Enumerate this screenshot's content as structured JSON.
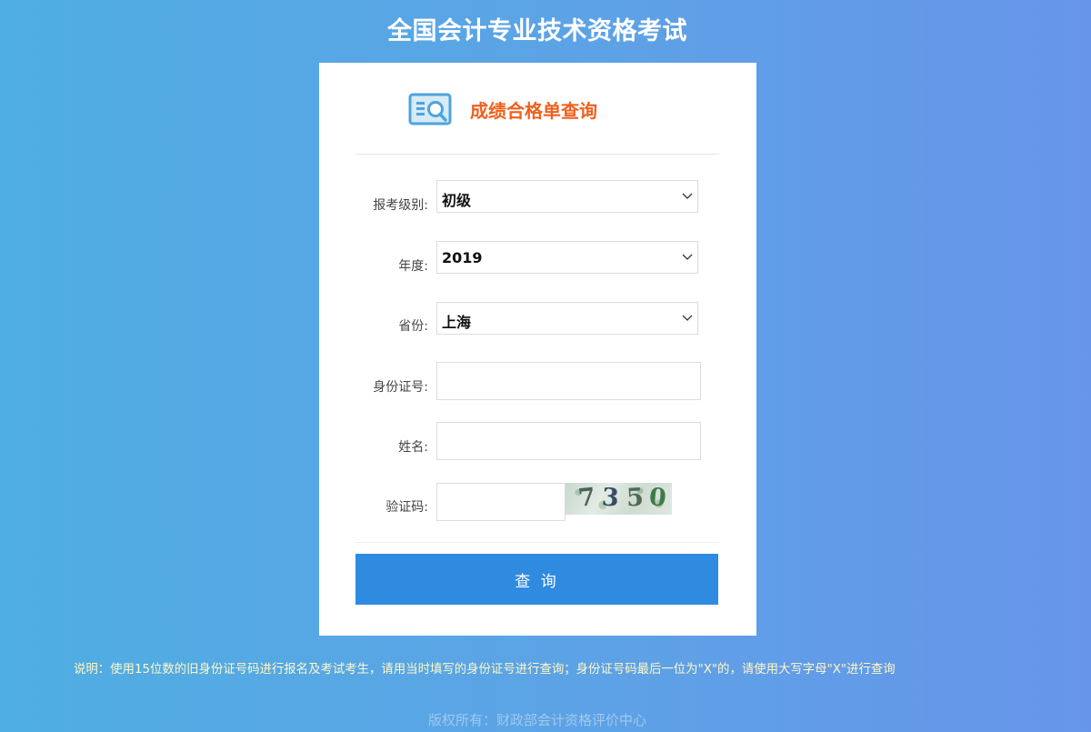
{
  "page": {
    "title": "全国会计专业技术资格考试"
  },
  "card": {
    "header_title": "成绩合格单查询",
    "header_icon": "search-document-icon"
  },
  "form": {
    "level": {
      "label": "报考级别:",
      "value": "初级"
    },
    "year": {
      "label": "年度:",
      "value": "2019"
    },
    "province": {
      "label": "省份:",
      "value": "上海"
    },
    "id_number": {
      "label": "身份证号:",
      "value": "",
      "placeholder": ""
    },
    "name": {
      "label": "姓名:",
      "value": "",
      "placeholder": ""
    },
    "captcha": {
      "label": "验证码:",
      "value": "",
      "placeholder": "",
      "image_digits": [
        "7",
        "3",
        "5",
        "0"
      ]
    },
    "submit_label": "查 询"
  },
  "footer": {
    "note": "说明：使用15位数的旧身份证号码进行报名及考试考生，请用当时填写的身份证号进行查询；身份证号码最后一位为\"X\"的，请使用大写字母\"X\"进行查询",
    "copyright": "版权所有：财政部会计资格评价中心"
  },
  "colors": {
    "background_left": "#4faee2",
    "background_right": "#6795ea",
    "header_title": "#f0601e",
    "button": "#2f8be0",
    "note_text": "#fff7c8"
  }
}
